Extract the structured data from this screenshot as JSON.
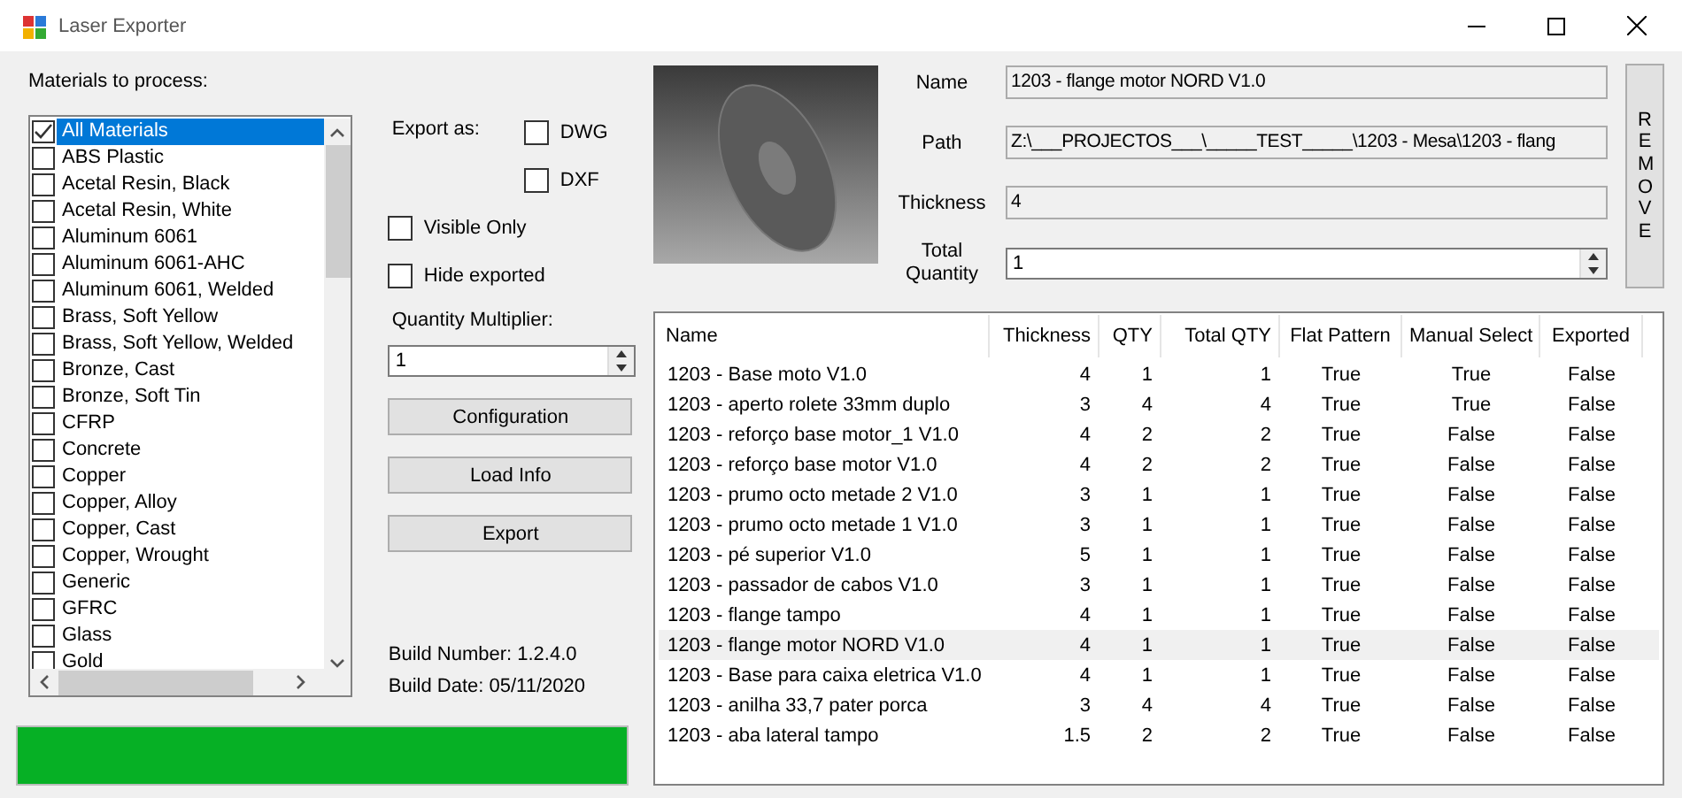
{
  "window": {
    "title": "Laser Exporter"
  },
  "materials": {
    "label": "Materials to process:",
    "items": [
      {
        "label": "All Materials",
        "checked": true,
        "selected": true
      },
      {
        "label": "ABS Plastic",
        "checked": false,
        "selected": false
      },
      {
        "label": "Acetal Resin, Black",
        "checked": false,
        "selected": false
      },
      {
        "label": "Acetal Resin, White",
        "checked": false,
        "selected": false
      },
      {
        "label": "Aluminum 6061",
        "checked": false,
        "selected": false
      },
      {
        "label": "Aluminum 6061-AHC",
        "checked": false,
        "selected": false
      },
      {
        "label": "Aluminum 6061, Welded",
        "checked": false,
        "selected": false
      },
      {
        "label": "Brass, Soft Yellow",
        "checked": false,
        "selected": false
      },
      {
        "label": "Brass, Soft Yellow, Welded",
        "checked": false,
        "selected": false
      },
      {
        "label": "Bronze, Cast",
        "checked": false,
        "selected": false
      },
      {
        "label": "Bronze, Soft Tin",
        "checked": false,
        "selected": false
      },
      {
        "label": "CFRP",
        "checked": false,
        "selected": false
      },
      {
        "label": "Concrete",
        "checked": false,
        "selected": false
      },
      {
        "label": "Copper",
        "checked": false,
        "selected": false
      },
      {
        "label": "Copper, Alloy",
        "checked": false,
        "selected": false
      },
      {
        "label": "Copper, Cast",
        "checked": false,
        "selected": false
      },
      {
        "label": "Copper, Wrought",
        "checked": false,
        "selected": false
      },
      {
        "label": "Generic",
        "checked": false,
        "selected": false
      },
      {
        "label": "GFRC",
        "checked": false,
        "selected": false
      },
      {
        "label": "Glass",
        "checked": false,
        "selected": false
      },
      {
        "label": "Gold",
        "checked": false,
        "selected": false
      }
    ]
  },
  "export_as": {
    "label": "Export as:",
    "dwg": {
      "label": "DWG",
      "checked": false
    },
    "dxf": {
      "label": "DXF",
      "checked": false
    }
  },
  "visible_only": {
    "label": "Visible Only",
    "checked": false
  },
  "hide_exported": {
    "label": "Hide exported",
    "checked": false
  },
  "quantity_multiplier": {
    "label": "Quantity Multiplier:",
    "value": "1"
  },
  "buttons": [
    "Configuration",
    "Load Info",
    "Export"
  ],
  "build": {
    "number_label": "Build Number:",
    "number": "1.2.4.0",
    "date_label": "Build  Date:",
    "date": "05/11/2020"
  },
  "progress": {
    "level": 1.0
  },
  "details": {
    "name_label": "Name",
    "name": "1203 - flange motor NORD V1.0",
    "path_label": "Path",
    "path": "Z:\\___PROJECTOS___\\_____TEST_____\\1203 - Mesa\\1203 - flang",
    "thickness_label": "Thickness",
    "thickness": "4",
    "total_label": "Total Quantity",
    "total": "1"
  },
  "remove_button": "REMOVE",
  "table": {
    "columns": [
      "Name",
      "Thickness",
      "QTY",
      "Total QTY",
      "Flat Pattern",
      "Manual Select",
      "Exported"
    ],
    "rows": [
      {
        "cells": [
          "1203 - Base moto V1.0",
          "4",
          "1",
          "1",
          "True",
          "True",
          "False"
        ],
        "selected": false
      },
      {
        "cells": [
          "1203 - aperto rolete 33mm duplo",
          "3",
          "4",
          "4",
          "True",
          "True",
          "False"
        ],
        "selected": false
      },
      {
        "cells": [
          "1203 - reforço base motor_1 V1.0",
          "4",
          "2",
          "2",
          "True",
          "False",
          "False"
        ],
        "selected": false
      },
      {
        "cells": [
          "1203 - reforço base motor V1.0",
          "4",
          "2",
          "2",
          "True",
          "False",
          "False"
        ],
        "selected": false
      },
      {
        "cells": [
          "1203 - prumo octo metade 2 V1.0",
          "3",
          "1",
          "1",
          "True",
          "False",
          "False"
        ],
        "selected": false
      },
      {
        "cells": [
          "1203 - prumo octo metade 1 V1.0",
          "3",
          "1",
          "1",
          "True",
          "False",
          "False"
        ],
        "selected": false
      },
      {
        "cells": [
          "1203 - pé superior V1.0",
          "5",
          "1",
          "1",
          "True",
          "False",
          "False"
        ],
        "selected": false
      },
      {
        "cells": [
          "1203 - passador de cabos V1.0",
          "3",
          "1",
          "1",
          "True",
          "False",
          "False"
        ],
        "selected": false
      },
      {
        "cells": [
          "1203 - flange tampo",
          "4",
          "1",
          "1",
          "True",
          "False",
          "False"
        ],
        "selected": false
      },
      {
        "cells": [
          "1203 - flange motor NORD V1.0",
          "4",
          "1",
          "1",
          "True",
          "False",
          "False"
        ],
        "selected": true
      },
      {
        "cells": [
          "1203 - Base para caixa eletrica V1.0",
          "4",
          "1",
          "1",
          "True",
          "False",
          "False"
        ],
        "selected": false
      },
      {
        "cells": [
          "1203 - anilha 33,7 pater porca",
          "3",
          "4",
          "4",
          "True",
          "False",
          "False"
        ],
        "selected": false
      },
      {
        "cells": [
          "1203 - aba lateral tampo",
          "1.5",
          "2",
          "2",
          "True",
          "False",
          "False"
        ],
        "selected": false
      }
    ]
  }
}
